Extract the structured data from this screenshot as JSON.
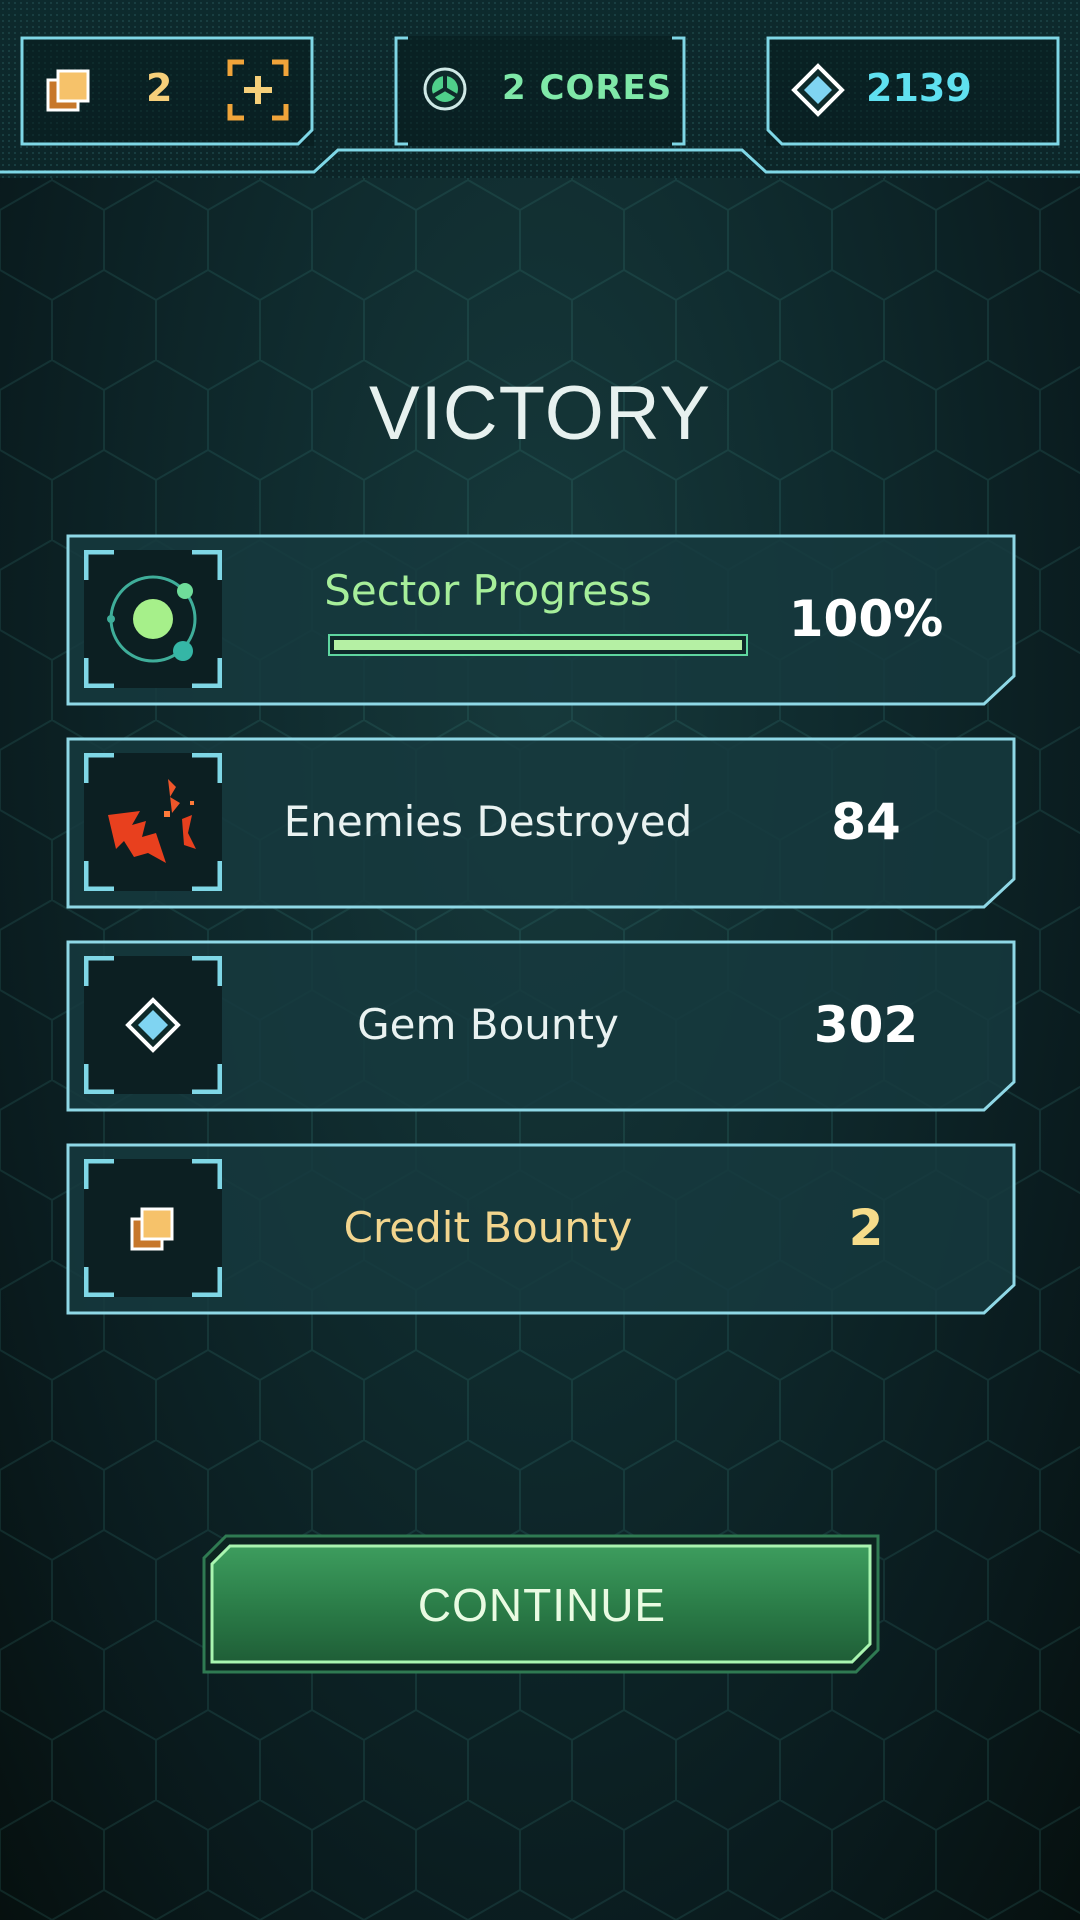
{
  "hud": {
    "credits": {
      "value": "2",
      "icon": "credits-icon",
      "add_icon": "add-credits-icon",
      "color": "#f6cf7a"
    },
    "cores": {
      "label": "2 CORES",
      "icon": "core-icon",
      "color": "#7fe8a8"
    },
    "gems": {
      "value": "2139",
      "icon": "gem-icon",
      "color": "#5fe0f0"
    }
  },
  "title": "VICTORY",
  "results": [
    {
      "label": "Sector Progress",
      "value": "100%",
      "icon": "planet-orbit-icon",
      "progress": 1.0
    },
    {
      "label": "Enemies Destroyed",
      "value": "84",
      "icon": "destroyed-enemy-icon"
    },
    {
      "label": "Gem Bounty",
      "value": "302",
      "icon": "gem-icon"
    },
    {
      "label": "Credit Bounty",
      "value": "2",
      "icon": "credits-icon"
    }
  ],
  "continue_label": "CONTINUE",
  "colors": {
    "accent": "#7fd7e6",
    "progress_green": "#a6ee9a",
    "credit_gold": "#f2d58e",
    "button_green": "#2e8a4f"
  }
}
